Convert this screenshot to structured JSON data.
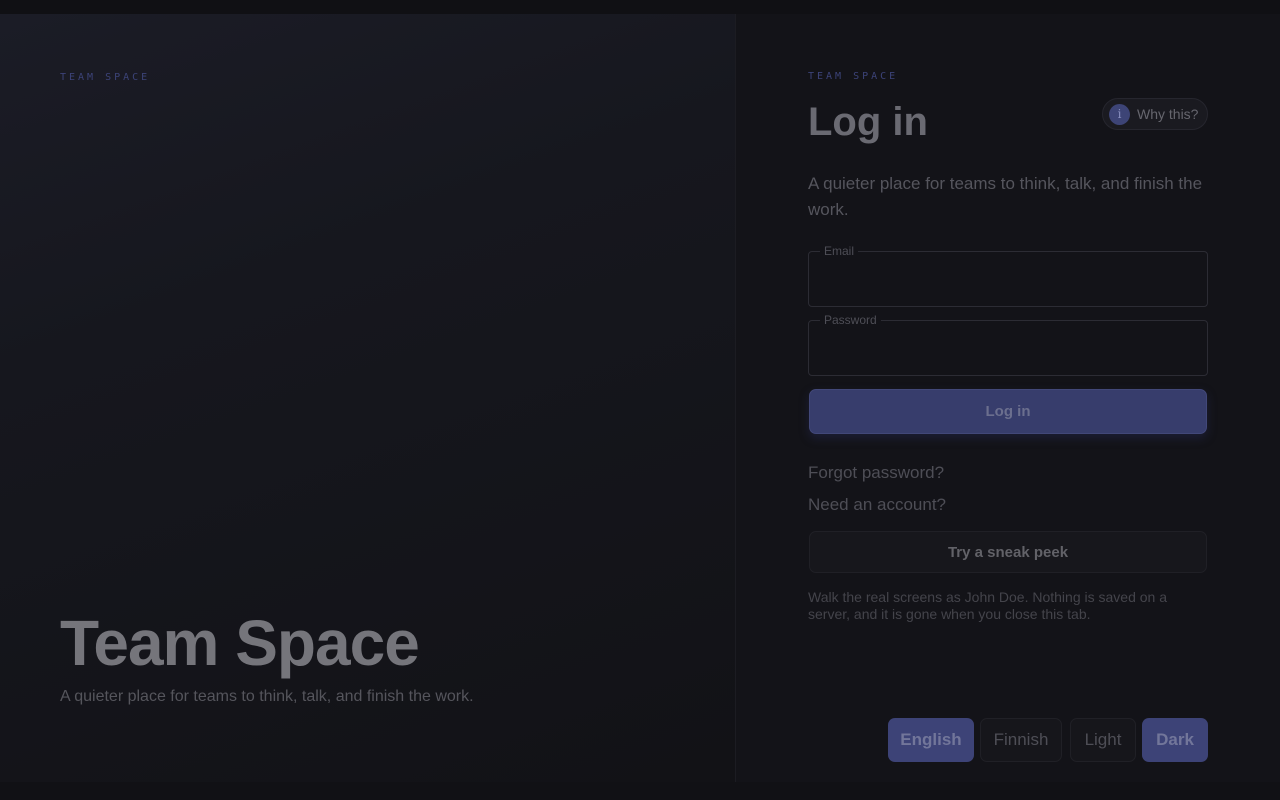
{
  "brand": {
    "eyebrow": "TEAM SPACE",
    "title": "Team Space",
    "tagline": "A quieter place for teams to think, talk, and finish the work."
  },
  "login": {
    "eyebrow": "TEAM SPACE",
    "title": "Log in",
    "subtitle": "A quieter place for teams to think, talk, and finish the work.",
    "why_label": "Why this?",
    "why_icon": "info-icon",
    "email_label": "Email",
    "email_value": "",
    "password_label": "Password",
    "password_value": "",
    "submit_label": "Log in",
    "forgot_link": "Forgot password?",
    "need_account_link": "Need an account?",
    "sneak_peek_label": "Try a sneak peek",
    "sneak_peek_note": "Walk the real screens as John Doe. Nothing is saved on a server, and it is gone when you close this tab."
  },
  "settings": {
    "language_options": [
      "English",
      "Finnish"
    ],
    "language_selected": "English",
    "theme_options": [
      "Light",
      "Dark"
    ],
    "theme_selected": "Dark"
  },
  "colors": {
    "accent": "#3d4377",
    "background": "#131318"
  }
}
